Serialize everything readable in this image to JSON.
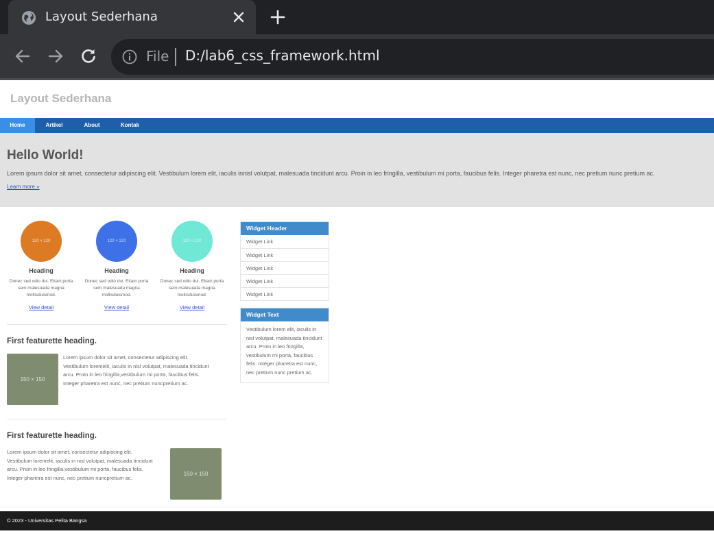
{
  "browser": {
    "tab_title": "Layout Sederhana",
    "scheme_label": "File",
    "url": "D:/lab6_css_framework.html"
  },
  "site": {
    "title": "Layout Sederhana",
    "nav": [
      "Home",
      "Artikel",
      "About",
      "Kontak"
    ]
  },
  "hero": {
    "title": "Hello World!",
    "text": "Lorem ipsum dolor sit amet, consectetur adipiscing elit. Vestibulum lorem elit, iaculis innisl volutpat, malesuada tincidunt arcu. Proin in leo fringilla, vestibulum mi porta, faucibus felis. Integer pharetra est nunc, nec pretium nunc pretium ac.",
    "link": "Learn more »"
  },
  "cards": [
    {
      "placeholder": "120 × 120",
      "heading": "Heading",
      "text": "Donec sed odio dui. Etiam porta sem malesuada magna mollisduismod.",
      "link": "View detail",
      "color": "#dd7b25"
    },
    {
      "placeholder": "120 × 120",
      "heading": "Heading",
      "text": "Donec sed odio dui. Etiam porta sem malesuada magna mollisduismod.",
      "link": "View detail",
      "color": "#3e71e8"
    },
    {
      "placeholder": "120 × 120",
      "heading": "Heading",
      "text": "Donec sed odio dui. Etiam porta sem malesuada magna mollisduismod.",
      "link": "View detail",
      "color": "#6fe8d6"
    }
  ],
  "featurettes": [
    {
      "heading": "First featurette heading.",
      "image": "150 × 150",
      "text": "Lorem ipsum dolor sit amet, consectetur adipiscing elit. Vestibulum loremelit, iaculis in nisl volutpat, malesuada tincidunt arcu. Proin in leo fringilla,vestibulum mi porta, faucibus felis. Integer pharetra est nunc, nec pretium nuncpretium ac."
    },
    {
      "heading": "First featurette heading.",
      "image": "150 × 150",
      "text": "Lorem ipsum dolor sit amet, consectetur adipiscing elit. Vestibulum loremelit, iaculis in nisl volutpat, malesuada tincidunt arcu. Proin in leo fringilla,vestibulum mi porta, faucibus felis. Integer pharetra est nunc, nec pretium nuncpretium ac."
    }
  ],
  "widgets": {
    "links_header": "Widget Header",
    "links": [
      "Widget Link",
      "Widget Link",
      "Widget Link",
      "Widget Link",
      "Widget Link"
    ],
    "text_header": "Widget Text",
    "text": "Vestibulum lorem elit, iaculis in nisl volutpat, malesuada tincidunt arcu. Proin in leo fringilla, vestibulum mi porta, faucibus felis. Integer pharetra est nunc, nec pretium nunc pretium ac."
  },
  "footer": {
    "text": "© 2023 - Universitas Pelita Bangsa"
  },
  "colors": {
    "navbar": "#1f5faa",
    "nav_active": "#3a8ee6",
    "widget_header": "#428bca",
    "featurette_image": "#7f8c70",
    "footer": "#1d1d1d"
  }
}
